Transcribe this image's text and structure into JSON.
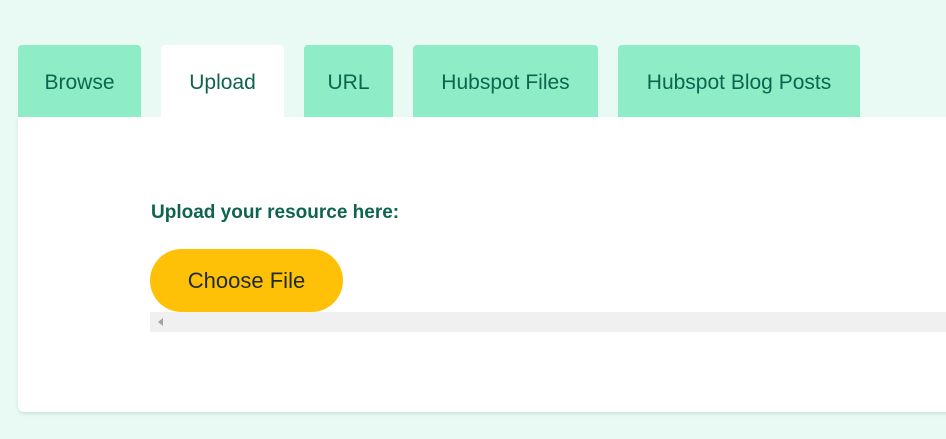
{
  "tabs": [
    {
      "label": "Browse",
      "active": false
    },
    {
      "label": "Upload",
      "active": true
    },
    {
      "label": "URL",
      "active": false
    },
    {
      "label": "Hubspot Files",
      "active": false
    },
    {
      "label": "Hubspot Blog Posts",
      "active": false
    }
  ],
  "upload": {
    "label": "Upload your resource here:",
    "choose_file_label": "Choose File"
  },
  "icons": {
    "scroll_left": "triangle-left-icon"
  },
  "colors": {
    "page_background": "#e8faf3",
    "tab_background": "#8eedc7",
    "tab_text": "#0f6450",
    "active_tab_background": "#ffffff",
    "button_background": "#ffc107",
    "button_text": "#1f2a2a",
    "scrollbar_track": "#f0f0f0"
  }
}
